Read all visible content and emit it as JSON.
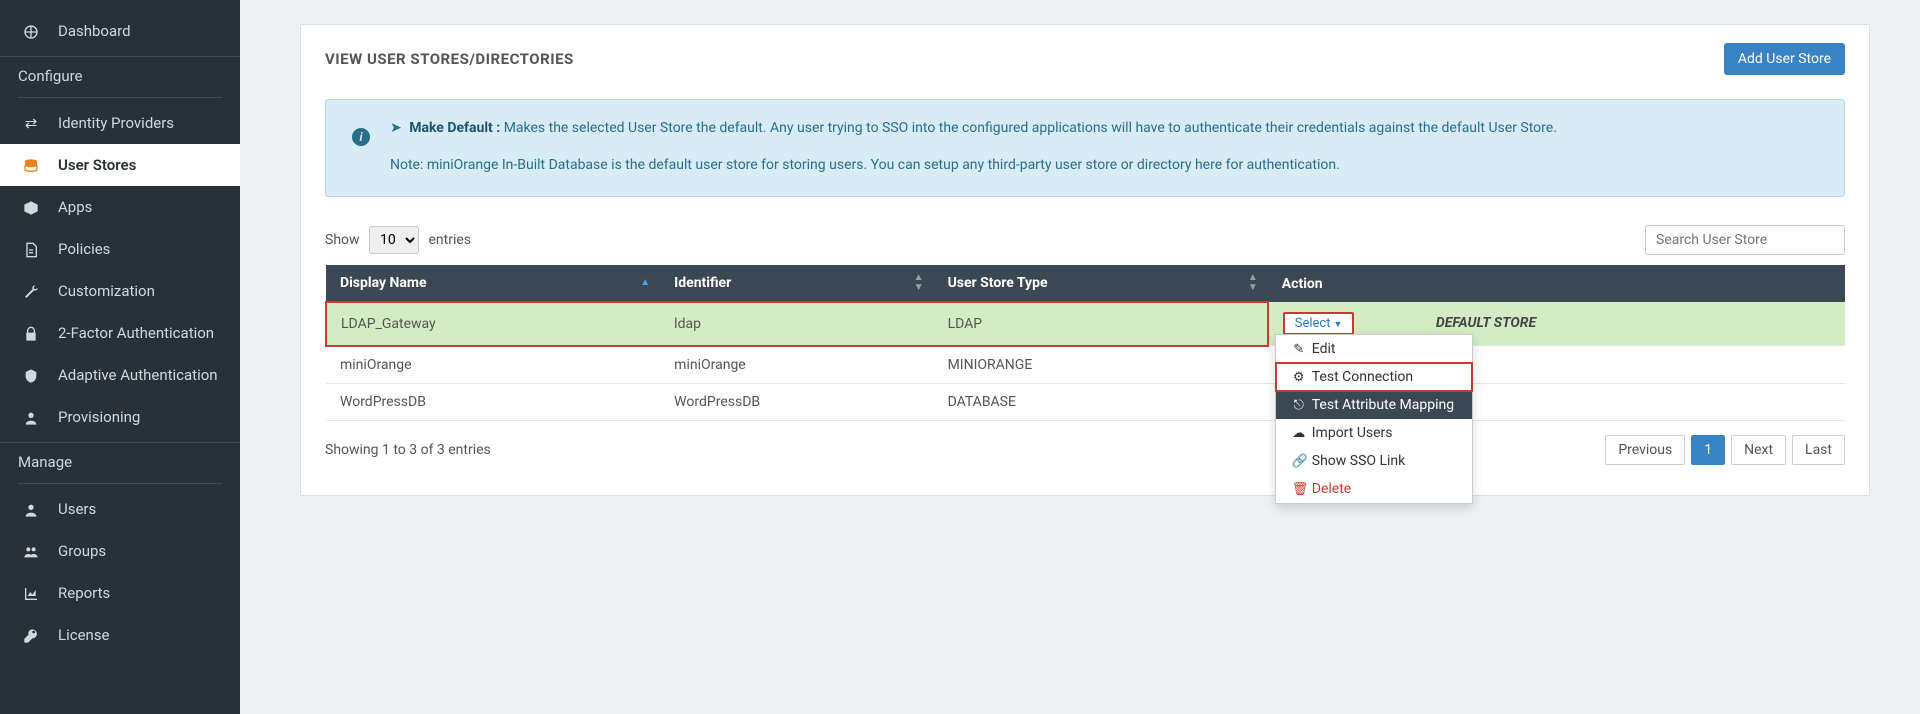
{
  "sidebar": {
    "items": [
      {
        "label": "Dashboard",
        "icon": "dashboard-icon",
        "active": false
      }
    ],
    "sections": {
      "configure": {
        "heading": "Configure",
        "items": [
          {
            "label": "Identity Providers",
            "icon": "exchange-icon",
            "active": false
          },
          {
            "label": "User Stores",
            "icon": "server-icon",
            "active": true
          },
          {
            "label": "Apps",
            "icon": "box-icon",
            "active": false
          },
          {
            "label": "Policies",
            "icon": "file-icon",
            "active": false
          },
          {
            "label": "Customization",
            "icon": "wrench-icon",
            "active": false
          },
          {
            "label": "2-Factor Authentication",
            "icon": "lock-icon",
            "active": false
          },
          {
            "label": "Adaptive Authentication",
            "icon": "shield-icon",
            "active": false
          },
          {
            "label": "Provisioning",
            "icon": "user-icon",
            "active": false
          }
        ]
      },
      "manage": {
        "heading": "Manage",
        "items": [
          {
            "label": "Users",
            "icon": "user-icon"
          },
          {
            "label": "Groups",
            "icon": "group-icon"
          },
          {
            "label": "Reports",
            "icon": "chart-icon"
          },
          {
            "label": "License",
            "icon": "key-icon"
          }
        ]
      }
    }
  },
  "page": {
    "title": "VIEW USER STORES/DIRECTORIES",
    "add_button": "Add User Store"
  },
  "info": {
    "make_default_title": "Make Default :",
    "make_default_text": "Makes the selected User Store the default. Any user trying to SSO into the configured applications will have to authenticate their credentials against the default User Store.",
    "note": "Note: miniOrange In-Built Database is the default user store for storing users. You can setup any third-party user store or directory here for authentication."
  },
  "table": {
    "show_label_pre": "Show",
    "show_value": "10",
    "show_label_post": "entries",
    "search_placeholder": "Search User Store",
    "headers": {
      "display_name": "Display Name",
      "identifier": "Identifier",
      "user_store_type": "User Store Type",
      "action": "Action"
    },
    "rows": [
      {
        "display_name": "LDAP_Gateway",
        "identifier": "ldap",
        "type": "LDAP",
        "default": true,
        "highlight": true
      },
      {
        "display_name": "miniOrange",
        "identifier": "miniOrange",
        "type": "MINIORANGE",
        "default": false,
        "highlight": false
      },
      {
        "display_name": "WordPressDB",
        "identifier": "WordPressDB",
        "type": "DATABASE",
        "default": false,
        "highlight": false
      }
    ],
    "default_badge": "DEFAULT STORE",
    "select_label": "Select",
    "footer_text": "Showing 1 to 3 of 3 entries",
    "pagination": {
      "prev": "Previous",
      "pages": [
        "1"
      ],
      "next": "Next",
      "last": "Last",
      "active": "1"
    }
  },
  "dropdown": {
    "edit": "Edit",
    "test_connection": "Test Connection",
    "test_attribute_mapping": "Test Attribute Mapping",
    "import_users": "Import Users",
    "show_sso_link": "Show SSO Link",
    "delete": "Delete"
  }
}
